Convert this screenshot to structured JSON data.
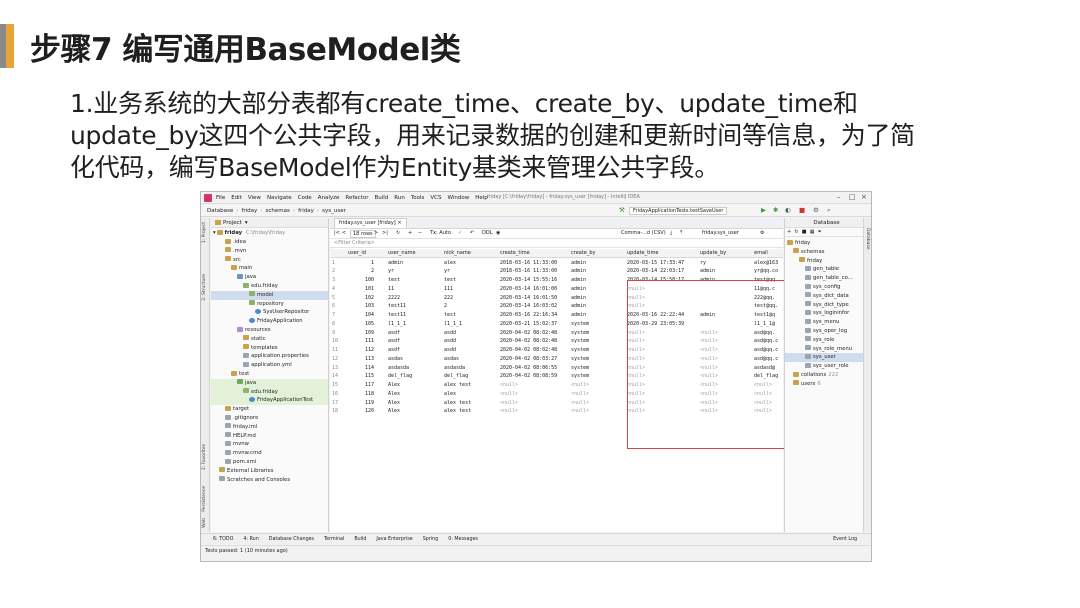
{
  "slide": {
    "title": "步骤7 编写通用BaseModel类",
    "body_lines": [
      "1.业务系统的大部分表都有create_time、create_by、update_time和",
      "update_by这四个公共字段，用来记录数据的创建和更新时间等信息，为了简",
      "化代码，编写BaseModel作为Entity基类来管理公共字段。"
    ],
    "accent_colors": [
      "#8a8a8a",
      "#e8a23a"
    ]
  },
  "ide": {
    "menu": [
      "File",
      "Edit",
      "View",
      "Navigate",
      "Code",
      "Analyze",
      "Refactor",
      "Build",
      "Run",
      "Tools",
      "VCS",
      "Window",
      "Help"
    ],
    "window_title": "friday [C:\\friday\\friday] - friday.sys_user [friday] - IntelliJ IDEA",
    "breadcrumbs": [
      "Database",
      "friday",
      "schemas",
      "friday",
      "sys_user"
    ],
    "run_config": "FridayApplicationTests.testSaveUser",
    "left_strip": [
      "1: Project",
      "2: Structure",
      "2: Favorites",
      "Persistence",
      "Web"
    ],
    "right_strip": [
      "Database"
    ],
    "project_panel": {
      "title": "Project",
      "root": "friday",
      "root_path": "C:\\friday\\friday",
      "tree": [
        {
          "label": ".idea",
          "indent": 2,
          "icon": "folder"
        },
        {
          "label": ".mvn",
          "indent": 2,
          "icon": "folder"
        },
        {
          "label": "src",
          "indent": 2,
          "icon": "folder"
        },
        {
          "label": "main",
          "indent": 3,
          "icon": "folder"
        },
        {
          "label": "java",
          "indent": 4,
          "icon": "src"
        },
        {
          "label": "edu.friday",
          "indent": 5,
          "icon": "pkg"
        },
        {
          "label": "model",
          "indent": 6,
          "icon": "pkg",
          "selected": true
        },
        {
          "label": "repository",
          "indent": 6,
          "icon": "pkg"
        },
        {
          "label": "SysUserRepositor",
          "indent": 7,
          "icon": "class"
        },
        {
          "label": "FridayApplication",
          "indent": 6,
          "icon": "class"
        },
        {
          "label": "resources",
          "indent": 4,
          "icon": "res"
        },
        {
          "label": "static",
          "indent": 5,
          "icon": "folder"
        },
        {
          "label": "templates",
          "indent": 5,
          "icon": "folder"
        },
        {
          "label": "application.properties",
          "indent": 5,
          "icon": "file"
        },
        {
          "label": "application.yml",
          "indent": 5,
          "icon": "file"
        },
        {
          "label": "test",
          "indent": 3,
          "icon": "folder"
        },
        {
          "label": "java",
          "indent": 4,
          "icon": "test",
          "green": true
        },
        {
          "label": "edu.friday",
          "indent": 5,
          "icon": "pkg",
          "green": true
        },
        {
          "label": "FridayApplicationTest",
          "indent": 6,
          "icon": "class",
          "green": true
        },
        {
          "label": "target",
          "indent": 2,
          "icon": "folder"
        },
        {
          "label": ".gitignore",
          "indent": 2,
          "icon": "file"
        },
        {
          "label": "friday.iml",
          "indent": 2,
          "icon": "file"
        },
        {
          "label": "HELP.md",
          "indent": 2,
          "icon": "file"
        },
        {
          "label": "mvnw",
          "indent": 2,
          "icon": "file"
        },
        {
          "label": "mvnw.cmd",
          "indent": 2,
          "icon": "file"
        },
        {
          "label": "pom.xml",
          "indent": 2,
          "icon": "file"
        },
        {
          "label": "External Libraries",
          "indent": 1,
          "icon": "folder"
        },
        {
          "label": "Scratches and Consoles",
          "indent": 1,
          "icon": "file"
        }
      ]
    },
    "editor": {
      "tab": "friday.sys_user [friday]",
      "rows_label": "18 rows",
      "tx_label": "Tx: Auto",
      "ddl_label": "DDL",
      "comma_label": "Comma-...d (CSV)",
      "filter_placeholder": "<Filter Criteria>",
      "context": "friday.sys_user",
      "columns": [
        "user_id",
        "user_name",
        "nick_name",
        "create_time",
        "create_by",
        "update_time",
        "update_by",
        "email"
      ],
      "rows": [
        [
          "1",
          "admin",
          "alex",
          "2018-03-16 11:33:00",
          "admin",
          "2020-03-15 17:33:47",
          "ry",
          "alex@163"
        ],
        [
          "2",
          "yr",
          "yr",
          "2018-03-16 11:33:00",
          "admin",
          "2020-03-14 22:03:17",
          "admin",
          "yr@qq.co"
        ],
        [
          "100",
          "test",
          "test",
          "2020-03-14 15:55:16",
          "admin",
          "2020-03-14 15:58:17",
          "admin",
          "test@qq."
        ],
        [
          "101",
          "11",
          "111",
          "2020-03-14 16:01:00",
          "admin",
          "<null>",
          "",
          "11@qq.c"
        ],
        [
          "102",
          "2222",
          "222",
          "2020-03-14 16:01:50",
          "admin",
          "<null>",
          "",
          "222@qq."
        ],
        [
          "103",
          "test11",
          "2",
          "2020-03-14 16:03:02",
          "admin",
          "<null>",
          "",
          "test@qq."
        ],
        [
          "104",
          "test11",
          "test",
          "2020-03-16 22:16:34",
          "admin",
          "2020-03-16 22:22:44",
          "admin",
          "test1@q"
        ],
        [
          "105",
          "l1_1_1",
          "l1_1_1",
          "2020-03-21 15:02:37",
          "system",
          "2020-03-29 23:05:39",
          "",
          "l1_1_1@"
        ],
        [
          "109",
          "asdf",
          "asdd",
          "2020-04-02 08:02:48",
          "system",
          "<null>",
          "<null>",
          "asd@qq."
        ],
        [
          "111",
          "asdf",
          "asdd",
          "2020-04-02 08:02:48",
          "system",
          "<null>",
          "<null>",
          "asd@qq.c"
        ],
        [
          "112",
          "asdf",
          "asdd",
          "2020-04-02 08:02:48",
          "system",
          "<null>",
          "<null>",
          "asd@qq.c"
        ],
        [
          "113",
          "asdas",
          "asdas",
          "2020-04-02 08:03:27",
          "system",
          "<null>",
          "<null>",
          "asd@qq.c"
        ],
        [
          "114",
          "asdasda",
          "asdasda",
          "2020-04-02 08:06:55",
          "system",
          "<null>",
          "<null>",
          "asdasd@"
        ],
        [
          "115",
          "del_flag",
          "del_flag",
          "2020-04-02 08:08:59",
          "system",
          "<null>",
          "<null>",
          "del_flag"
        ],
        [
          "117",
          "Alex",
          "alex test",
          "<null>",
          "<null>",
          "<null>",
          "<null>",
          "<null>"
        ],
        [
          "118",
          "Alex",
          "alex",
          "<null>",
          "<null>",
          "<null>",
          "<null>",
          "<null>"
        ],
        [
          "119",
          "Alex",
          "alex test",
          "<null>",
          "<null>",
          "<null>",
          "<null>",
          "<null>"
        ],
        [
          "120",
          "Alex",
          "alex test",
          "<null>",
          "<null>",
          "<null>",
          "<null>",
          "<null>"
        ]
      ]
    },
    "database_panel": {
      "title": "Database",
      "tree": [
        {
          "label": "friday",
          "indent": 0
        },
        {
          "label": "schemas",
          "indent": 1
        },
        {
          "label": "friday",
          "indent": 2
        },
        {
          "label": "gen_table",
          "indent": 3
        },
        {
          "label": "gen_table_co...",
          "indent": 3
        },
        {
          "label": "sys_config",
          "indent": 3
        },
        {
          "label": "sys_dict_data",
          "indent": 3
        },
        {
          "label": "sys_dict_type",
          "indent": 3
        },
        {
          "label": "sys_logininfor",
          "indent": 3
        },
        {
          "label": "sys_menu",
          "indent": 3
        },
        {
          "label": "sys_oper_log",
          "indent": 3
        },
        {
          "label": "sys_role",
          "indent": 3
        },
        {
          "label": "sys_role_menu",
          "indent": 3
        },
        {
          "label": "sys_user",
          "indent": 3,
          "selected": true
        },
        {
          "label": "sys_user_role",
          "indent": 3
        },
        {
          "label": "collations",
          "indent": 1,
          "extra": "222"
        },
        {
          "label": "users",
          "indent": 1,
          "extra": "6"
        }
      ]
    },
    "tool_windows": [
      "6: TODO",
      "4: Run",
      "Database Changes",
      "Terminal",
      "Build",
      "Java Enterprise",
      "Spring",
      "0: Messages"
    ],
    "event_log": "Event Log",
    "status": "Tests passed: 1 (10 minutes ago)"
  }
}
